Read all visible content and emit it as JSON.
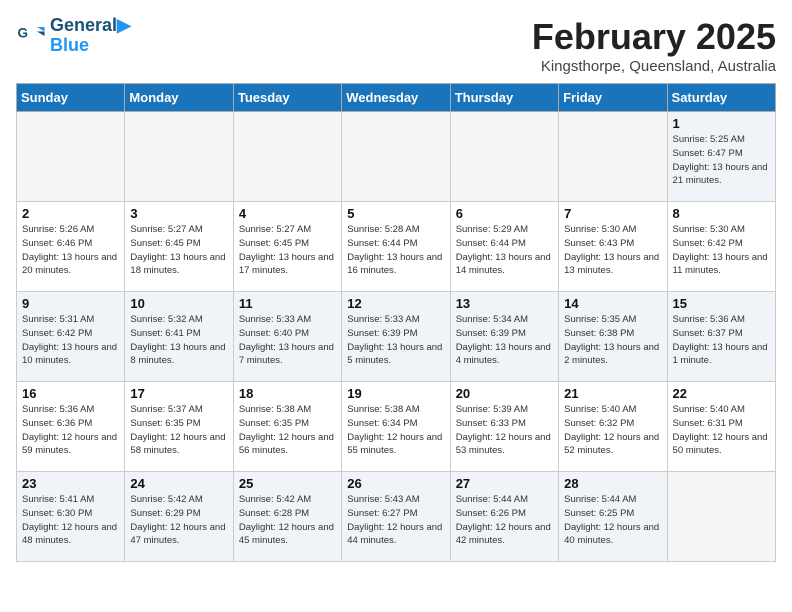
{
  "header": {
    "logo_line1": "General",
    "logo_line2": "Blue",
    "month": "February 2025",
    "location": "Kingsthorpe, Queensland, Australia"
  },
  "days_of_week": [
    "Sunday",
    "Monday",
    "Tuesday",
    "Wednesday",
    "Thursday",
    "Friday",
    "Saturday"
  ],
  "weeks": [
    [
      {
        "day": "",
        "info": "",
        "empty": true
      },
      {
        "day": "",
        "info": "",
        "empty": true
      },
      {
        "day": "",
        "info": "",
        "empty": true
      },
      {
        "day": "",
        "info": "",
        "empty": true
      },
      {
        "day": "",
        "info": "",
        "empty": true
      },
      {
        "day": "",
        "info": "",
        "empty": true
      },
      {
        "day": "1",
        "info": "Sunrise: 5:25 AM\nSunset: 6:47 PM\nDaylight: 13 hours\nand 21 minutes.",
        "empty": false
      }
    ],
    [
      {
        "day": "2",
        "info": "Sunrise: 5:26 AM\nSunset: 6:46 PM\nDaylight: 13 hours\nand 20 minutes.",
        "empty": false
      },
      {
        "day": "3",
        "info": "Sunrise: 5:27 AM\nSunset: 6:45 PM\nDaylight: 13 hours\nand 18 minutes.",
        "empty": false
      },
      {
        "day": "4",
        "info": "Sunrise: 5:27 AM\nSunset: 6:45 PM\nDaylight: 13 hours\nand 17 minutes.",
        "empty": false
      },
      {
        "day": "5",
        "info": "Sunrise: 5:28 AM\nSunset: 6:44 PM\nDaylight: 13 hours\nand 16 minutes.",
        "empty": false
      },
      {
        "day": "6",
        "info": "Sunrise: 5:29 AM\nSunset: 6:44 PM\nDaylight: 13 hours\nand 14 minutes.",
        "empty": false
      },
      {
        "day": "7",
        "info": "Sunrise: 5:30 AM\nSunset: 6:43 PM\nDaylight: 13 hours\nand 13 minutes.",
        "empty": false
      },
      {
        "day": "8",
        "info": "Sunrise: 5:30 AM\nSunset: 6:42 PM\nDaylight: 13 hours\nand 11 minutes.",
        "empty": false
      }
    ],
    [
      {
        "day": "9",
        "info": "Sunrise: 5:31 AM\nSunset: 6:42 PM\nDaylight: 13 hours\nand 10 minutes.",
        "empty": false
      },
      {
        "day": "10",
        "info": "Sunrise: 5:32 AM\nSunset: 6:41 PM\nDaylight: 13 hours\nand 8 minutes.",
        "empty": false
      },
      {
        "day": "11",
        "info": "Sunrise: 5:33 AM\nSunset: 6:40 PM\nDaylight: 13 hours\nand 7 minutes.",
        "empty": false
      },
      {
        "day": "12",
        "info": "Sunrise: 5:33 AM\nSunset: 6:39 PM\nDaylight: 13 hours\nand 5 minutes.",
        "empty": false
      },
      {
        "day": "13",
        "info": "Sunrise: 5:34 AM\nSunset: 6:39 PM\nDaylight: 13 hours\nand 4 minutes.",
        "empty": false
      },
      {
        "day": "14",
        "info": "Sunrise: 5:35 AM\nSunset: 6:38 PM\nDaylight: 13 hours\nand 2 minutes.",
        "empty": false
      },
      {
        "day": "15",
        "info": "Sunrise: 5:36 AM\nSunset: 6:37 PM\nDaylight: 13 hours\nand 1 minute.",
        "empty": false
      }
    ],
    [
      {
        "day": "16",
        "info": "Sunrise: 5:36 AM\nSunset: 6:36 PM\nDaylight: 12 hours\nand 59 minutes.",
        "empty": false
      },
      {
        "day": "17",
        "info": "Sunrise: 5:37 AM\nSunset: 6:35 PM\nDaylight: 12 hours\nand 58 minutes.",
        "empty": false
      },
      {
        "day": "18",
        "info": "Sunrise: 5:38 AM\nSunset: 6:35 PM\nDaylight: 12 hours\nand 56 minutes.",
        "empty": false
      },
      {
        "day": "19",
        "info": "Sunrise: 5:38 AM\nSunset: 6:34 PM\nDaylight: 12 hours\nand 55 minutes.",
        "empty": false
      },
      {
        "day": "20",
        "info": "Sunrise: 5:39 AM\nSunset: 6:33 PM\nDaylight: 12 hours\nand 53 minutes.",
        "empty": false
      },
      {
        "day": "21",
        "info": "Sunrise: 5:40 AM\nSunset: 6:32 PM\nDaylight: 12 hours\nand 52 minutes.",
        "empty": false
      },
      {
        "day": "22",
        "info": "Sunrise: 5:40 AM\nSunset: 6:31 PM\nDaylight: 12 hours\nand 50 minutes.",
        "empty": false
      }
    ],
    [
      {
        "day": "23",
        "info": "Sunrise: 5:41 AM\nSunset: 6:30 PM\nDaylight: 12 hours\nand 48 minutes.",
        "empty": false
      },
      {
        "day": "24",
        "info": "Sunrise: 5:42 AM\nSunset: 6:29 PM\nDaylight: 12 hours\nand 47 minutes.",
        "empty": false
      },
      {
        "day": "25",
        "info": "Sunrise: 5:42 AM\nSunset: 6:28 PM\nDaylight: 12 hours\nand 45 minutes.",
        "empty": false
      },
      {
        "day": "26",
        "info": "Sunrise: 5:43 AM\nSunset: 6:27 PM\nDaylight: 12 hours\nand 44 minutes.",
        "empty": false
      },
      {
        "day": "27",
        "info": "Sunrise: 5:44 AM\nSunset: 6:26 PM\nDaylight: 12 hours\nand 42 minutes.",
        "empty": false
      },
      {
        "day": "28",
        "info": "Sunrise: 5:44 AM\nSunset: 6:25 PM\nDaylight: 12 hours\nand 40 minutes.",
        "empty": false
      },
      {
        "day": "",
        "info": "",
        "empty": true
      }
    ]
  ]
}
